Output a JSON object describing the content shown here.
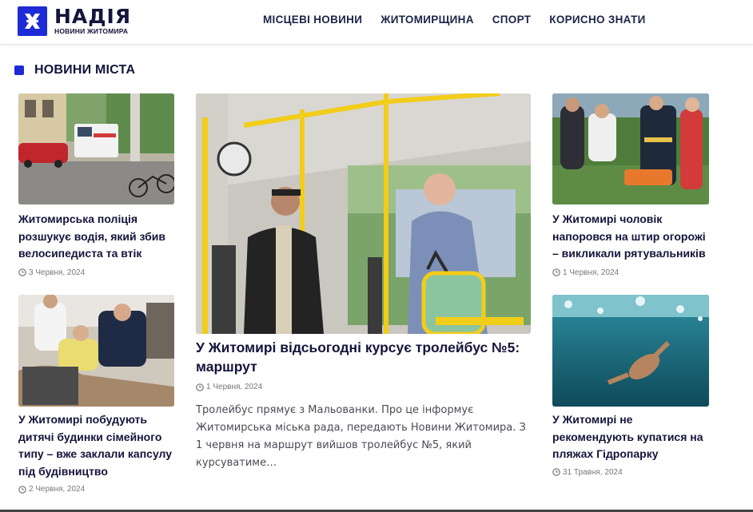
{
  "header": {
    "logo_name": "НАДІЯ",
    "logo_sub": "НОВИНИ ЖИТОМИРА",
    "nav": [
      "МІСЦЕВІ НОВИНИ",
      "ЖИТОМИРЩИНА",
      "СПОРТ",
      "КОРИСНО ЗНАТИ"
    ]
  },
  "section": {
    "title": "НОВИНИ МІСТА"
  },
  "articles": {
    "left_top": {
      "title": "Житомирська поліція розшукує водія, який збив велосипедиста та втік",
      "date": "3 Червня, 2024"
    },
    "left_bottom": {
      "title": "У Житомирі побудують дитячі будинки сімейного типу – вже заклали капсулу під будівництво",
      "date": "2 Червня, 2024"
    },
    "main": {
      "title": "У Житомирі відсьогодні курсує тролейбус №5: маршрут",
      "date": "1 Червня, 2024",
      "excerpt": "Тролейбус прямує з Мальованки. Про це інформує Житомирська міська рада, передають Новини Житомира. З 1 червня на маршрут вийшов тролейбус №5, який курсуватиме…"
    },
    "right_top": {
      "title": "У Житомирі чоловік напоровся на штир огорожі – викликали рятувальників",
      "date": "1 Червня, 2024"
    },
    "right_bottom": {
      "title": "У Житомирі не рекомендують купатися на пляжах Гідропарку",
      "date": "31 Травня, 2024"
    }
  },
  "colors": {
    "brand": "#1d2bd6",
    "heading": "#14143c"
  }
}
